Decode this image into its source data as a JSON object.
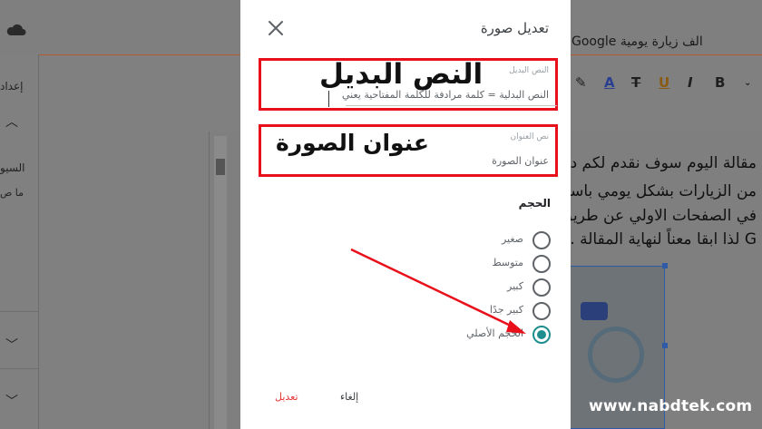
{
  "dialog": {
    "title": "تعديل صورة",
    "alt_field": {
      "label": "النص البديل",
      "value": "النص البدلية = كلمة مرادفة للكلمة المفتاحية يعني",
      "annotation": "النص البديل"
    },
    "title_field": {
      "label": "نص العنوان",
      "value": "عنوان الصورة",
      "annotation": "عنوان الصورة"
    },
    "size": {
      "heading": "الحجم",
      "options": [
        {
          "label": "صغير",
          "selected": false
        },
        {
          "label": "متوسط",
          "selected": false
        },
        {
          "label": "كبير",
          "selected": false
        },
        {
          "label": "كبير جدًا",
          "selected": false
        },
        {
          "label": "الحجم الأصلي",
          "selected": true
        }
      ]
    },
    "buttons": {
      "cancel": "إلغاء",
      "edit": "تعديل"
    }
  },
  "background": {
    "doc_title": "الف زيارة يومية Google",
    "sidebar": {
      "item1": "إعداد",
      "item2": "السيو",
      "item3": "ما ص"
    },
    "body_lines": [
      "مقالة اليوم سوف نقدم لكم دليل",
      "من الزيارات بشكل يومي باستخ",
      "في الصفحات الاولي عن طريق",
      "G لذا ابقا معناً لنهاية المقالة ."
    ]
  },
  "watermark": "www.nabdtek.com",
  "colors": {
    "annotation_red": "#e8101a",
    "radio_accent": "#1e8e8e",
    "edit_button": "#e53935"
  }
}
